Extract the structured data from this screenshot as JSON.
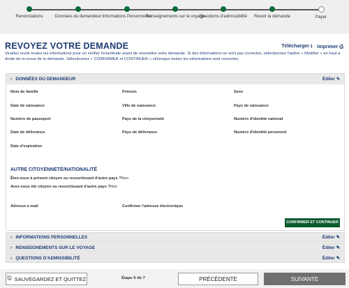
{
  "progress": {
    "steps": [
      {
        "label": "Renonciations"
      },
      {
        "label": "Données du demandeur"
      },
      {
        "label": "Informations Personnelles"
      },
      {
        "label": "Renseignements sur le voyage"
      },
      {
        "label": "Questions d'admissibilité"
      },
      {
        "label": "Revoir la demande"
      },
      {
        "label": "Payer"
      }
    ],
    "current_step": 6
  },
  "header": {
    "title": "REVOYEZ VOTRE DEMANDE",
    "download_label": "Télécharger",
    "print_label": "Imprimer",
    "intro": "Veuillez revoir toutes les informations pour en vérifier l'exactitude avant de soumettre votre demande. Si des informations ne sont pas correctes, sélectionnez l'option « Modifier » en haut à droite de la revue de la demande. Sélectionnez « CONFIRMER et CONTINUER » si/lorsque toutes les informations sont correctes."
  },
  "applicant": {
    "section_title": "DONNÉES DU DEMANDEUR",
    "edit_label": "Éditer",
    "fields": {
      "nom": "Nom de famille",
      "prenom": "Prénom",
      "sexe": "Sexe",
      "dob": "Date de naissance",
      "city_birth": "Ville de naissance",
      "country_birth": "Pays de naissance",
      "passport": "Numéro de passeport",
      "citizenship": "Pays de la citoyenneté",
      "national_id": "Numéro d'identité national",
      "issue_date": "Date de délivrance",
      "issue_country": "Pays de délivrance",
      "personal_id": "Numéro d'identité personnel",
      "expiry": "Date d'expiration"
    },
    "other_citizenship": {
      "title": "AUTRE CITOYENNETÉ/NATIONALITÉ",
      "q1": "Êtes-vous à présent citoyen ou ressortissant d'autre pays ?",
      "a1": "Non",
      "q2": "Avez-vous été citoyen ou ressortissant d'autre pays ?",
      "a2": "Non"
    },
    "email_label": "Adresse e-mail",
    "confirm_email_label": "Confirmer l'adresse électronique",
    "confirm_button": "CONFIRMER ET CONTINUER"
  },
  "sections": [
    {
      "title": "INFORMATIONS PERSONNELLES",
      "edit": "Éditer"
    },
    {
      "title": "RENSEIGNEMENTS SUR LE VOYAGE",
      "edit": "Éditer"
    },
    {
      "title": "QUESTIONS D'ADMISSIBILITÉ",
      "edit": "Éditer"
    }
  ],
  "footer": {
    "save_label": "SAUVEGARDEZ ET QUITTEZ",
    "step_text": "Étape 6 de 7",
    "prev_label": "PRÉCÉDENTE",
    "next_label": "SUIVANTE"
  },
  "icons": {
    "download": "download-icon",
    "print": "print-icon",
    "edit": "pencil-icon",
    "save": "save-icon",
    "chevron": "chevron-right-icon"
  },
  "colors": {
    "brand_blue": "#1f3c73",
    "confirm_green": "#0b5a2e",
    "step_done": "#0b6b3a",
    "next_button": "#6f6f6f"
  }
}
